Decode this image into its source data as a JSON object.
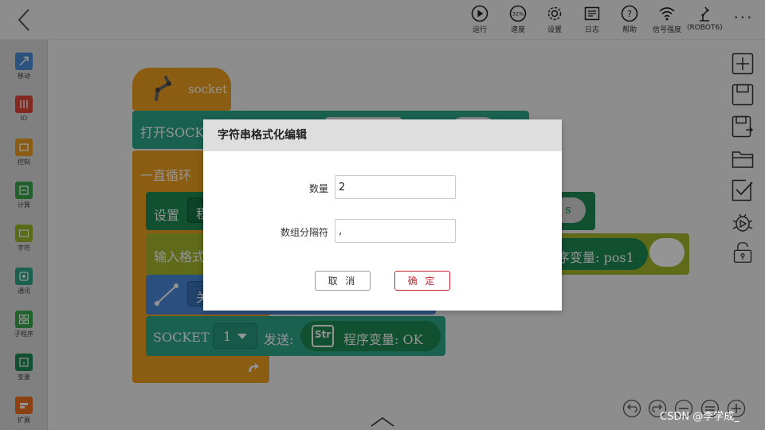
{
  "topbar": {
    "tools": [
      {
        "label": "运行",
        "icon": "play-icon"
      },
      {
        "label": "速度",
        "icon": "speed-icon",
        "value": "32%"
      },
      {
        "label": "设置",
        "icon": "gear-icon"
      },
      {
        "label": "日志",
        "icon": "log-icon"
      },
      {
        "label": "帮助",
        "icon": "help-icon"
      },
      {
        "label": "信号强度",
        "icon": "wifi-icon"
      },
      {
        "label": "(ROBOT6)",
        "icon": "robot-arm-icon"
      }
    ],
    "more": "···"
  },
  "sidebar": {
    "items": [
      {
        "label": "移动",
        "color": "#4a90d9"
      },
      {
        "label": "IO",
        "color": "#e0473c"
      },
      {
        "label": "控制",
        "color": "#f0a020"
      },
      {
        "label": "计算",
        "color": "#3aa84a"
      },
      {
        "label": "字符",
        "color": "#9cb82a"
      },
      {
        "label": "通讯",
        "color": "#2ea88a"
      },
      {
        "label": "子程序",
        "color": "#3aa84a"
      },
      {
        "label": "变量",
        "color": "#1e8a54"
      },
      {
        "label": "扩展",
        "color": "#f07020"
      }
    ]
  },
  "blocks": {
    "hat_label": "socket",
    "open_socket": "打开SOCK",
    "loop": "一直循环",
    "set": "设置",
    "set_partial": "程",
    "s_unit": "s",
    "input_format": "输入格式",
    "var_pos1": "序变量: pos1",
    "move_partial": "关",
    "socket_label": "SOCKET",
    "socket_num": "1",
    "send_label": "发送:",
    "str_badge": "Str",
    "var_ok": "程序变量: OK"
  },
  "dialog": {
    "title": "字符串格式化编辑",
    "count_label": "数量",
    "count_value": "2",
    "separator_label": "数组分隔符",
    "separator_value": ",",
    "cancel": "取 消",
    "confirm": "确 定"
  },
  "watermark": "CSDN @李学成_",
  "colors": {
    "control_orange": "#f0a020",
    "comm_teal": "#2ea88a",
    "var_green": "#1e8a54",
    "str_olive": "#a4b82a",
    "move_blue": "#4a88d9",
    "confirm_red": "#c8242f"
  }
}
